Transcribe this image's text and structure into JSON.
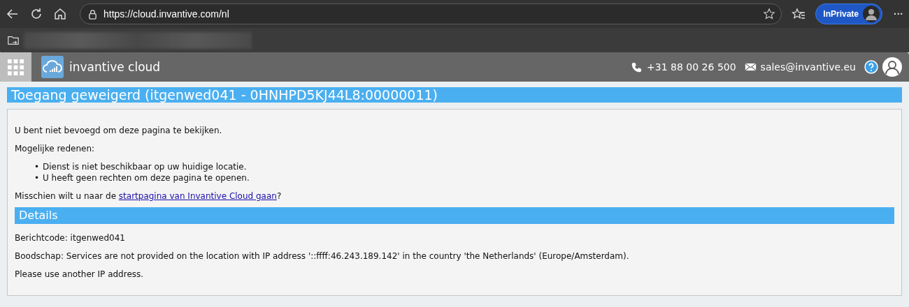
{
  "browser": {
    "url": "https://cloud.invantive.com/nl",
    "profile_label": "InPrivate",
    "menu_glyph": "···"
  },
  "header": {
    "brand": "invantive cloud",
    "phone": "+31 88 00 26 500",
    "email": "sales@invantive.eu"
  },
  "title": "Toegang geweigerd (itgenwed041 - 0HNHPD5KJ44L8:00000011)",
  "intro": "U bent niet bevoegd om deze pagina te bekijken.",
  "reasons_label": "Mogelijke redenen:",
  "reasons": [
    {
      "bullet": "•",
      "text": "Dienst is niet beschikbaar op uw huidige locatie."
    },
    {
      "bullet": "•",
      "text": "U heeft geen rechten om deze pagina te openen."
    }
  ],
  "suggestion": {
    "before": "Misschien wilt u naar de ",
    "link": "startpagina van Invantive Cloud gaan",
    "after": "?"
  },
  "details": {
    "heading": "Details",
    "lines": [
      "Berichtcode: itgenwed041",
      "Boodschap: Services are not provided on the location with IP address '::ffff:46.243.189.142' in the country 'the Netherlands' (Europe/Amsterdam).",
      "Please use another IP address."
    ]
  }
}
